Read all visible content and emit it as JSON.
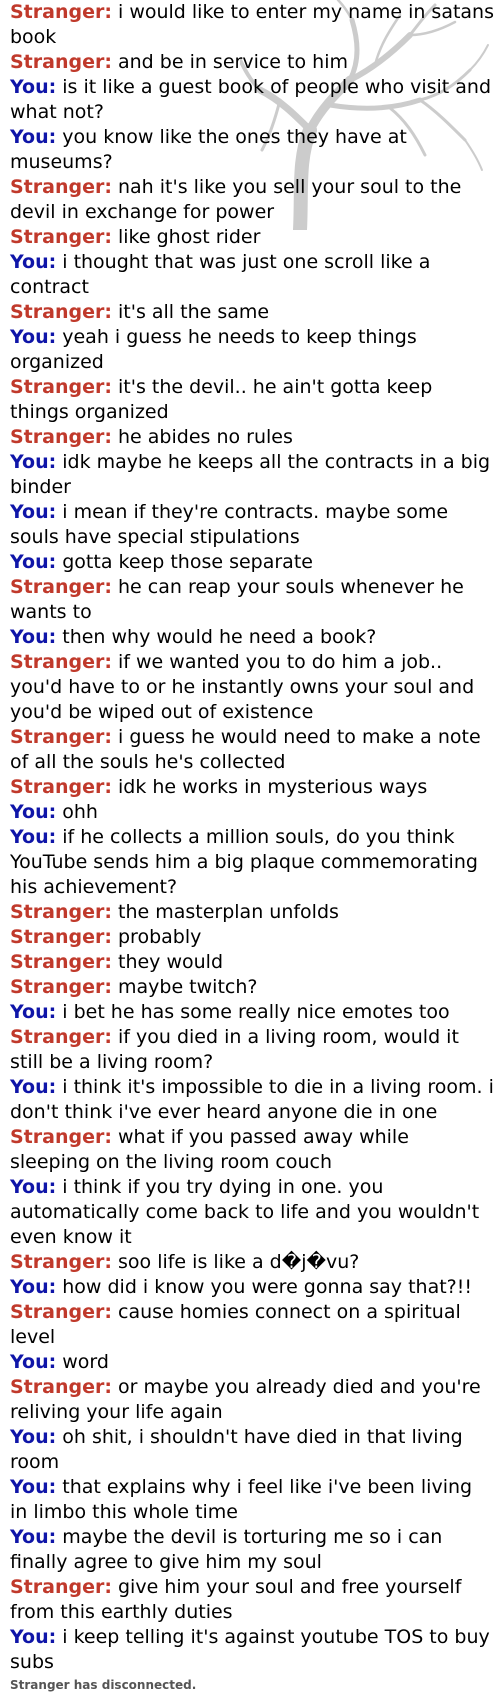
{
  "colors": {
    "stranger": "#c0392b",
    "you": "#0f15a8",
    "status": "#555555",
    "watermark": "#cccccc"
  },
  "watermark": {
    "icon": "tree-icon"
  },
  "messages": [
    {
      "speaker": "Stranger:",
      "role": "stranger",
      "text": "i would like to enter my name in satans book"
    },
    {
      "speaker": "Stranger:",
      "role": "stranger",
      "text": "and be in service to him"
    },
    {
      "speaker": "You:",
      "role": "you",
      "text": "is it like a guest book of people who visit and what not?"
    },
    {
      "speaker": "You:",
      "role": "you",
      "text": "you know like the ones they have at museums?"
    },
    {
      "speaker": "Stranger:",
      "role": "stranger",
      "text": "nah it's like you sell your soul to the devil in exchange for power"
    },
    {
      "speaker": "Stranger:",
      "role": "stranger",
      "text": "like ghost rider"
    },
    {
      "speaker": "You:",
      "role": "you",
      "text": "i thought that was just one scroll like a contract"
    },
    {
      "speaker": "Stranger:",
      "role": "stranger",
      "text": "it's all the same"
    },
    {
      "speaker": "You:",
      "role": "you",
      "text": "yeah i guess he needs to keep things organized"
    },
    {
      "speaker": "Stranger:",
      "role": "stranger",
      "text": "it's the devil.. he ain't gotta keep things organized"
    },
    {
      "speaker": "Stranger:",
      "role": "stranger",
      "text": "he abides no rules"
    },
    {
      "speaker": "You:",
      "role": "you",
      "text": "idk maybe he keeps all the contracts in a big binder"
    },
    {
      "speaker": "You:",
      "role": "you",
      "text": "i mean if they're contracts. maybe some souls have special stipulations"
    },
    {
      "speaker": "You:",
      "role": "you",
      "text": "gotta keep those separate"
    },
    {
      "speaker": "Stranger:",
      "role": "stranger",
      "text": "he can reap your souls whenever he wants to"
    },
    {
      "speaker": "You:",
      "role": "you",
      "text": "then why would he need a book?"
    },
    {
      "speaker": "Stranger:",
      "role": "stranger",
      "text": "if we wanted you to do him a job.. you'd have to or he instantly owns your soul and you'd be wiped out of existence"
    },
    {
      "speaker": "Stranger:",
      "role": "stranger",
      "text": "i guess he would need to make a note of all the souls he's collected"
    },
    {
      "speaker": "Stranger:",
      "role": "stranger",
      "text": "idk he works in mysterious ways"
    },
    {
      "speaker": "You:",
      "role": "you",
      "text": "ohh"
    },
    {
      "speaker": "You:",
      "role": "you",
      "text": "if he collects a million souls, do you think YouTube sends him a big plaque commemorating his achievement?"
    },
    {
      "speaker": "Stranger:",
      "role": "stranger",
      "text": "the masterplan unfolds"
    },
    {
      "speaker": "Stranger:",
      "role": "stranger",
      "text": "probably"
    },
    {
      "speaker": "Stranger:",
      "role": "stranger",
      "text": "they would"
    },
    {
      "speaker": "Stranger:",
      "role": "stranger",
      "text": "maybe twitch?"
    },
    {
      "speaker": "You:",
      "role": "you",
      "text": "i bet he has some really nice emotes too"
    },
    {
      "speaker": "Stranger:",
      "role": "stranger",
      "text": "if you died in a living room, would it still be a living room?"
    },
    {
      "speaker": "You:",
      "role": "you",
      "text": "i think it's impossible to die in a living room. i don't think i've ever heard anyone die in one"
    },
    {
      "speaker": "Stranger:",
      "role": "stranger",
      "text": "what if you passed away while sleeping on the living room couch"
    },
    {
      "speaker": "You:",
      "role": "you",
      "text": "i think if you try dying in one. you automatically come back to life and you wouldn't even know it"
    },
    {
      "speaker": "Stranger:",
      "role": "stranger",
      "text": "soo life is like a d�j�vu?"
    },
    {
      "speaker": "You:",
      "role": "you",
      "text": "how did i know you were gonna say that?!!"
    },
    {
      "speaker": "Stranger:",
      "role": "stranger",
      "text": "cause homies connect on a spiritual level"
    },
    {
      "speaker": "You:",
      "role": "you",
      "text": "word"
    },
    {
      "speaker": "Stranger:",
      "role": "stranger",
      "text": "or maybe you already died and you're reliving your life again"
    },
    {
      "speaker": "You:",
      "role": "you",
      "text": "oh shit, i shouldn't have died in that living room"
    },
    {
      "speaker": "You:",
      "role": "you",
      "text": "that explains why i feel like i've been living in limbo this whole time"
    },
    {
      "speaker": "You:",
      "role": "you",
      "text": "maybe the devil is torturing me so i can finally agree to give him my soul"
    },
    {
      "speaker": "Stranger:",
      "role": "stranger",
      "text": "give him your soul and free yourself from this earthly duties"
    },
    {
      "speaker": "You:",
      "role": "you",
      "text": "i keep telling it's against youtube TOS to buy subs"
    }
  ],
  "status": "Stranger has disconnected."
}
